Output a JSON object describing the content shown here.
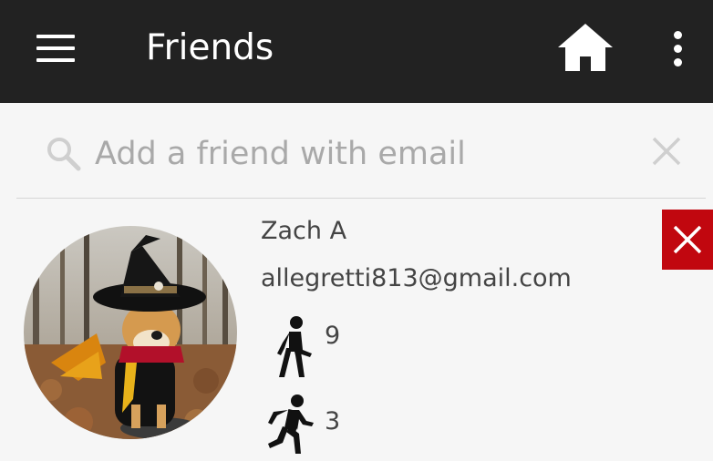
{
  "app_bar": {
    "title": "Friends",
    "menu_icon": "hamburger-menu-icon",
    "home_icon": "home-icon",
    "more_icon": "more-vertical-icon"
  },
  "search": {
    "placeholder": "Add a friend with email",
    "value": "",
    "search_icon": "search-icon",
    "clear_icon": "close-icon"
  },
  "friends": [
    {
      "name": "Zach A",
      "email": "allegretti813@gmail.com",
      "walk_count": "9",
      "run_count": "3",
      "walk_icon": "walking-icon",
      "run_icon": "running-icon",
      "remove_icon": "close-icon"
    }
  ],
  "colors": {
    "app_bar": "#222222",
    "background": "#f6f6f6",
    "remove_button": "#c1070f",
    "placeholder_text": "#a9a9a9",
    "icon_gray": "#cfcfcf"
  }
}
